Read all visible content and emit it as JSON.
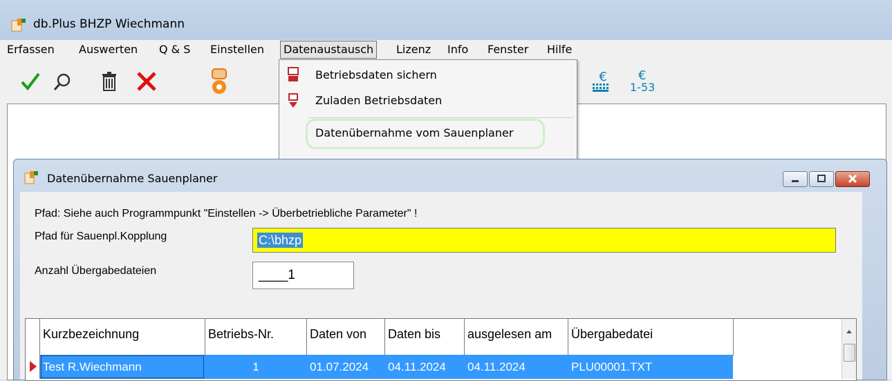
{
  "window": {
    "title": "db.Plus BHZP Wiechmann"
  },
  "menu": [
    {
      "label": "Erfassen"
    },
    {
      "label": "Auswerten"
    },
    {
      "label": "Q & S"
    },
    {
      "label": "Einstellen"
    },
    {
      "label": "Datenaustausch",
      "active": true
    },
    {
      "label": "Lizenz"
    },
    {
      "label": "Info"
    },
    {
      "label": "Fenster"
    },
    {
      "label": "Hilfe"
    }
  ],
  "toolbar": {
    "icons": [
      "checkmark-icon",
      "search-icon",
      "trash-icon",
      "delete-x-icon",
      "sow-icon",
      "euro-grid-icon",
      "euro-range-icon"
    ],
    "euro_symbol": "€",
    "euro_range_label": "1-53",
    "check_color": "#1a9e1a",
    "x_color": "#e01010",
    "euro_color": "#0a82b4"
  },
  "dropdown": {
    "items": [
      {
        "label": "Betriebsdaten sichern",
        "icon": "save-data-icon"
      },
      {
        "label": "Zuladen Betriebsdaten",
        "icon": "load-data-icon"
      },
      {
        "label": "Datenübernahme vom Sauenplaner",
        "icon": null
      }
    ]
  },
  "dialog": {
    "title": "Datenübernahme Sauenplaner",
    "info_text": "Pfad: Siehe auch Programmpunkt \"Einstellen -> Überbetriebliche Parameter\" !",
    "path_label": "Pfad für Sauenpl.Kopplung",
    "path_value": "C:\\bhzp",
    "count_label": "Anzahl Übergabedateien",
    "count_value": "____1",
    "field_highlight_color": "#ffff00"
  },
  "table": {
    "columns": [
      "Kurzbezeichnung",
      "Betriebs-Nr.",
      "Daten von",
      "Daten bis",
      "ausgelesen am",
      "Übergabedatei"
    ],
    "rows": [
      [
        "Test R.Wiechmann",
        "1",
        "01.07.2024",
        "04.11.2024",
        "04.11.2024",
        "PLU00001.TXT"
      ]
    ],
    "selected_row_color": "#3399ff"
  }
}
